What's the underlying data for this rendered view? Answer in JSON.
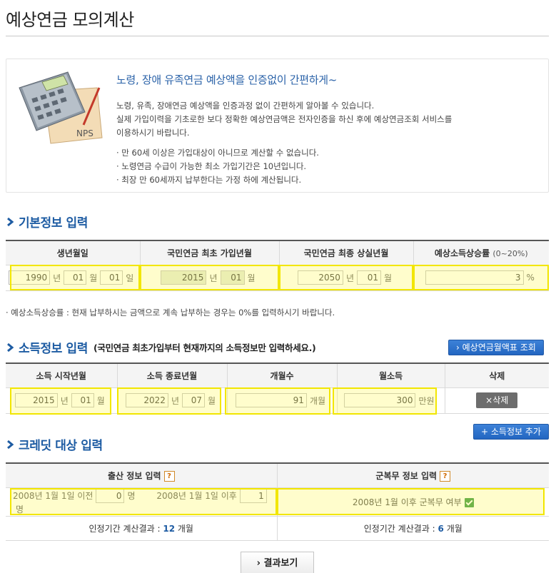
{
  "page": {
    "title": "예상연금 모의계산"
  },
  "intro": {
    "heading": "노령, 장애 유족연금 예상액을 인증없이 간편하게~",
    "line1": "노령, 유족, 장애연금 예상액을 인증과정 없이 간편하게 알아볼 수 있습니다.",
    "line2": "실제 가입이력을 기초로한 보다 정확한 예상연금액은 전자인증을 하신 후에 예상연금조회 서비스를",
    "line3": "이용하시기 바랍니다.",
    "bullet1": "· 만 60세 이상은 가입대상이 아니므로 계산할 수 없습니다.",
    "bullet2": "· 노령연금 수급이 가능한 최소 가입기간은 10년입니다.",
    "bullet3": "· 최장 만 60세까지 납부한다는 가정 하에 계산됩니다.",
    "art_label": "NPS"
  },
  "basic": {
    "title": "기본정보 입력",
    "headers": {
      "birth": "생년월일",
      "first_join": "국민연금 최초 가입년월",
      "last_loss": "국민연금 최종 상실년월",
      "growth": "예상소득상승률",
      "growth_range": "(0~20%)"
    },
    "birth_year": "1990",
    "birth_month": "01",
    "birth_day": "01",
    "join_year": "2015",
    "join_month": "01",
    "loss_year": "2050",
    "loss_month": "01",
    "growth_rate": "3",
    "note": "· 예상소득상승률 : 현재 납부하시는 금액으로 계속 납부하는 경우는 0%를 입력하시기 바랍니다."
  },
  "income": {
    "title": "소득정보 입력",
    "subtitle": "(국민연금 최초가입부터 현재까지의 소득정보만 입력하세요.)",
    "lookup_button": "› 예상연금월액표 조회",
    "headers": {
      "start": "소득 시작년월",
      "end": "소득 종료년월",
      "months": "개월수",
      "monthly": "월소득",
      "delete": "삭제"
    },
    "start_year": "2015",
    "start_month": "01",
    "end_year": "2022",
    "end_month": "07",
    "months": "91",
    "monthly": "300",
    "delete_button": "×삭제",
    "add_button": "+ 소득정보 추가"
  },
  "credit": {
    "title": "크레딧 대상 입력",
    "birth_header": "출산 정보 입력",
    "military_header": "군복무 정보 입력",
    "help": "?",
    "before_label": "2008년 1월 1일 이전",
    "before_value": "0",
    "after_label": "2008년 1월 1일 이후",
    "after_value": "1",
    "military_label": "2008년 1월 이후 군복무 여부",
    "birth_result_label": "인정기간 계산결과 :",
    "birth_result_value": "12",
    "military_result_label": "인정기간 계산결과 :",
    "military_result_value": "6"
  },
  "units": {
    "year": "년",
    "month": "월",
    "day": "일",
    "percent": "%",
    "months": "개월",
    "manwon": "만원",
    "person": "명"
  },
  "result_button": "› 결과보기",
  "colors": {
    "accent": "#1e5ca3",
    "highlight": "#f2e600"
  }
}
